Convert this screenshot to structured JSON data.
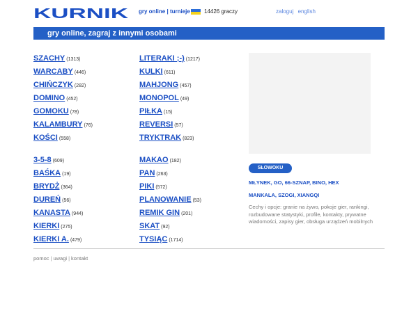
{
  "header": {
    "logo_text": "KURNIK",
    "logo_color": "#1b4fc4",
    "nav": [
      {
        "label": "gry online"
      },
      {
        "label": "turnieje"
      }
    ],
    "flag_colors": [
      "#2c6ed8",
      "#f5d21b"
    ],
    "players": "14426 graczy",
    "login": "zaloguj",
    "language": "english"
  },
  "banner": {
    "title": "gry online, zagraj z innymi osobami",
    "color": "#2460c6"
  },
  "games_col1": [
    {
      "name": "SZACHY",
      "count": "(1313)"
    },
    {
      "name": "WARCABY",
      "count": "(446)"
    },
    {
      "name": "CHIŃCZYK",
      "count": "(282)"
    },
    {
      "name": "DOMINO",
      "count": "(452)"
    },
    {
      "name": "GOMOKU",
      "count": "(78)"
    },
    {
      "name": "KALAMBURY",
      "count": "(76)"
    },
    {
      "name": "KOŚCI",
      "count": "(558)"
    },
    {
      "name": "3-5-8",
      "count": "(609)"
    },
    {
      "name": "BAŚKA",
      "count": "(19)"
    },
    {
      "name": "BRYDŻ",
      "count": "(364)"
    },
    {
      "name": "DUREŃ",
      "count": "(56)"
    },
    {
      "name": "KANASTA",
      "count": "(944)"
    },
    {
      "name": "KIERKI",
      "count": "(275)"
    },
    {
      "name": "KIERKI A.",
      "count": "(479)"
    }
  ],
  "games_col2": [
    {
      "name": "LITERAKI ;-)",
      "count": "(1217)"
    },
    {
      "name": "KULKI",
      "count": "(611)"
    },
    {
      "name": "MAHJONG",
      "count": "(457)"
    },
    {
      "name": "MONOPOL",
      "count": "(49)"
    },
    {
      "name": "PIŁKA",
      "count": "(15)"
    },
    {
      "name": "REVERSI",
      "count": "(57)"
    },
    {
      "name": "TRYKTRAK",
      "count": "(823)"
    },
    {
      "name": "MAKAO",
      "count": "(182)"
    },
    {
      "name": "PAN",
      "count": "(263)"
    },
    {
      "name": "PIKI",
      "count": "(572)"
    },
    {
      "name": "PLANOWANIE",
      "count": "(53)"
    },
    {
      "name": "REMIK GIN",
      "count": "(201)"
    },
    {
      "name": "SKAT",
      "count": "(92)"
    },
    {
      "name": "TYSIĄC",
      "count": "(1714)"
    }
  ],
  "sidebar": {
    "pill_label": "SŁOWOKU",
    "links_line1": [
      "MŁYNEK",
      "GO",
      "66-SZNAP",
      "BINO",
      "HEX"
    ],
    "links_line2": [
      "MANKALA",
      "SZOGI",
      "XIANGQI"
    ],
    "features": "Cechy i opcje: granie na żywo, pokoje gier, rankingi, rozbudowane statystyki, profile, kontakty, prywatne wiadomości, zapisy gier, obsługa urządzeń mobilnych"
  },
  "footer": {
    "links": [
      "pomoc",
      "uwagi",
      "kontakt"
    ]
  }
}
